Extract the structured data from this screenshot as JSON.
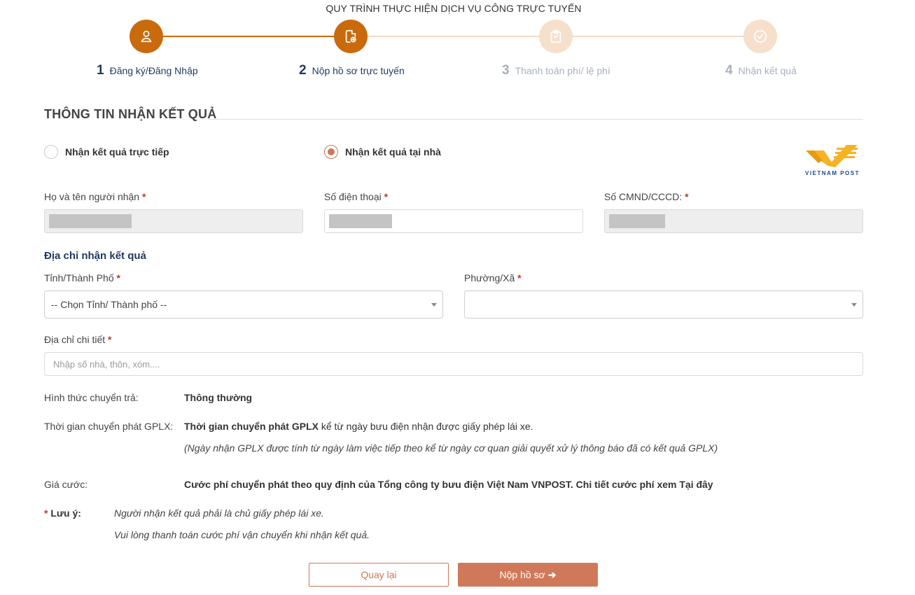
{
  "process": {
    "title": "QUY TRÌNH THỰC HIỆN DỊCH VỤ CÔNG TRỰC TUYẾN",
    "steps": [
      {
        "num": "1",
        "label": "Đăng ký/Đăng Nhập",
        "icon": "user-icon",
        "state": "done"
      },
      {
        "num": "2",
        "label": "Nộp hồ sơ trực tuyến",
        "icon": "document-upload-icon",
        "state": "active"
      },
      {
        "num": "3",
        "label": "Thanh toán phí/ lệ phí",
        "icon": "clipboard-icon",
        "state": "todo"
      },
      {
        "num": "4",
        "label": "Nhận kết quả",
        "icon": "check-circle-icon",
        "state": "todo"
      }
    ]
  },
  "section": {
    "title": "THÔNG TIN NHẬN KẾT QUẢ"
  },
  "delivery_options": [
    {
      "label": "Nhận kết quả trực tiếp",
      "checked": false
    },
    {
      "label": "Nhận kết quả tại nhà",
      "checked": true
    }
  ],
  "vnpost_logo": {
    "text": "VIETNAM POST",
    "color": "#f5b324"
  },
  "recipient": {
    "name_label": "Họ và tên người nhận",
    "phone_label": "Số điện thoại",
    "id_label": "Số CMND/CCCD:",
    "required_mark": "*"
  },
  "address": {
    "heading": "Địa chỉ nhận kết quả",
    "province_label": "Tỉnh/Thành Phố",
    "province_value": "-- Chọn Tỉnh/ Thành phố --",
    "ward_label": "Phường/Xã",
    "ward_value": "",
    "detail_label": "Địa chỉ chi tiết",
    "detail_placeholder": "Nhập số nhà, thôn, xóm...."
  },
  "info": {
    "method_label": "Hình thức chuyển trả:",
    "method_value": "Thông thường",
    "time_label": "Thời gian chuyển phát GPLX:",
    "time_value_bold": "Thời gian chuyển phát GPLX",
    "time_value_rest": " kể từ ngày bưu điện nhận được giấy phép lái xe.",
    "time_note": "(Ngày nhận GPLX được tính từ ngày làm việc tiếp theo kể từ ngày cơ quan giải quyết xử lý thông báo đã có kết quả GPLX)",
    "fee_label": "Giá cước:",
    "fee_value": "Cước phí chuyển phát theo quy định của Tổng công ty bưu điện Việt Nam VNPOST. Chi tiết cước phí xem Tại đây"
  },
  "note": {
    "mark": "*",
    "label": " Lưu ý:",
    "lines": [
      "Người nhận kết quả phải là chủ giấy phép lái xe.",
      "Vui lòng thanh toán cước phí vận chuyển khi nhận kết quả."
    ]
  },
  "buttons": {
    "back": "Quay lại",
    "submit": "Nộp hồ sơ",
    "submit_arrow": "➔"
  },
  "colors": {
    "accent": "#c96a0c",
    "button": "#d0795a",
    "navy": "#1f3a5f"
  }
}
